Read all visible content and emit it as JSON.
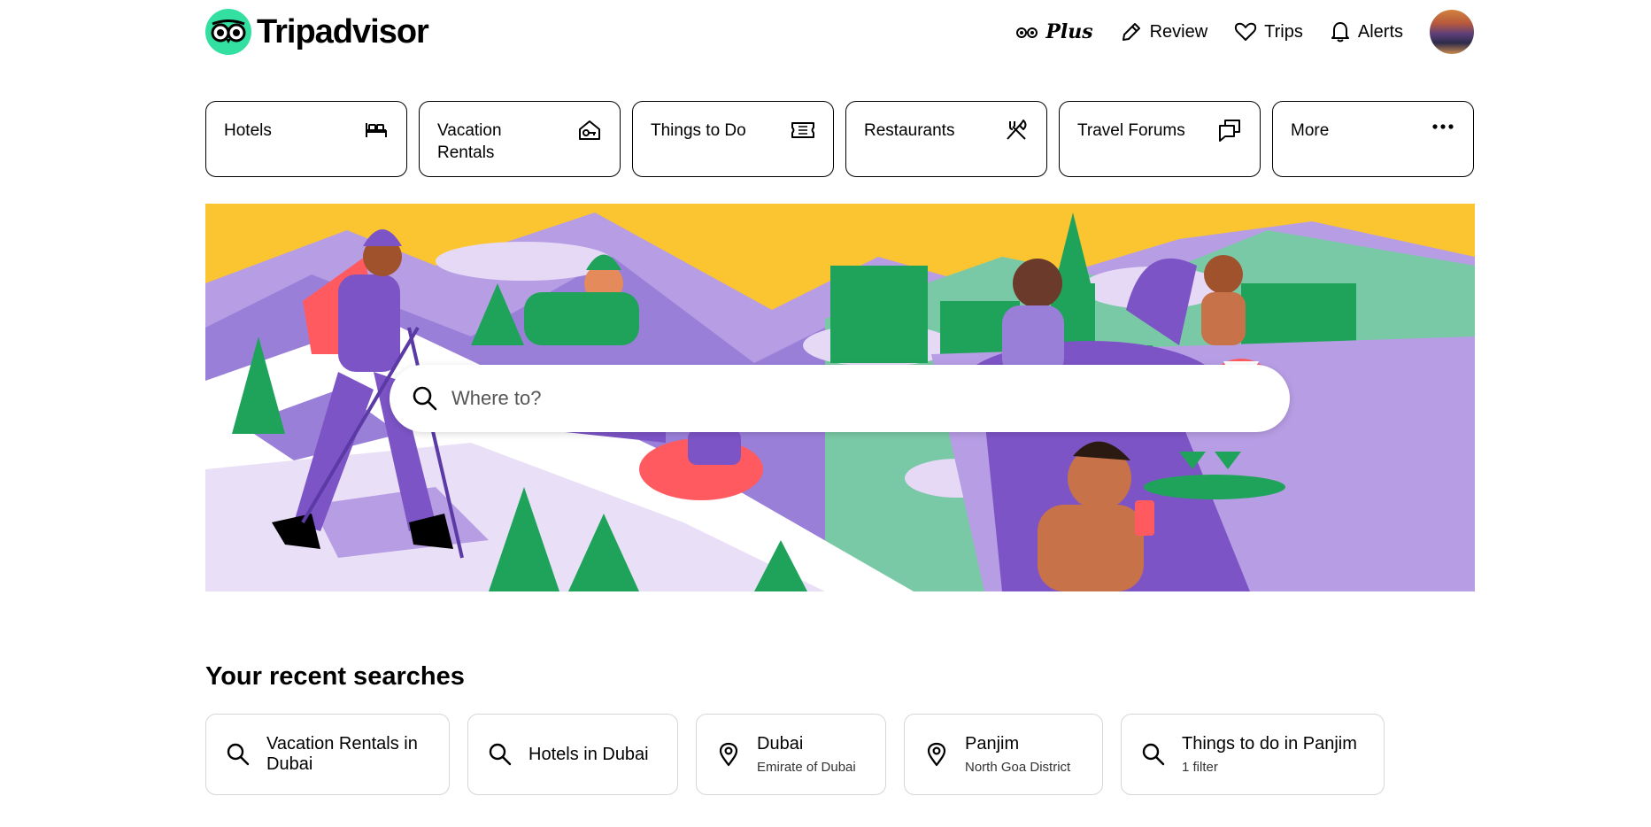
{
  "brand": {
    "name": "Tripadvisor",
    "accent": "#34e0a1"
  },
  "topnav": {
    "plus_label": "Plus",
    "review_label": "Review",
    "trips_label": "Trips",
    "alerts_label": "Alerts"
  },
  "categories": [
    {
      "label": "Hotels",
      "icon": "bed-icon"
    },
    {
      "label": "Vacation Rentals",
      "icon": "house-key-icon"
    },
    {
      "label": "Things to Do",
      "icon": "ticket-icon"
    },
    {
      "label": "Restaurants",
      "icon": "fork-knife-icon"
    },
    {
      "label": "Travel Forums",
      "icon": "chat-bubbles-icon"
    },
    {
      "label": "More",
      "icon": "more-dots-icon"
    }
  ],
  "search": {
    "placeholder": "Where to?"
  },
  "recent": {
    "title": "Your recent searches",
    "items": [
      {
        "icon": "search-icon",
        "main": "Vacation Rentals in Dubai",
        "sub": ""
      },
      {
        "icon": "search-icon",
        "main": "Hotels in Dubai",
        "sub": ""
      },
      {
        "icon": "location-pin-icon",
        "main": "Dubai",
        "sub": "Emirate of Dubai"
      },
      {
        "icon": "location-pin-icon",
        "main": "Panjim",
        "sub": "North Goa District"
      },
      {
        "icon": "search-icon",
        "main": "Things to do in Panjim",
        "sub": "1 filter"
      }
    ]
  },
  "colors": {
    "hero_sky": "#fbc531",
    "hero_purple": "#a78bdc",
    "hero_green": "#1fa35a"
  }
}
